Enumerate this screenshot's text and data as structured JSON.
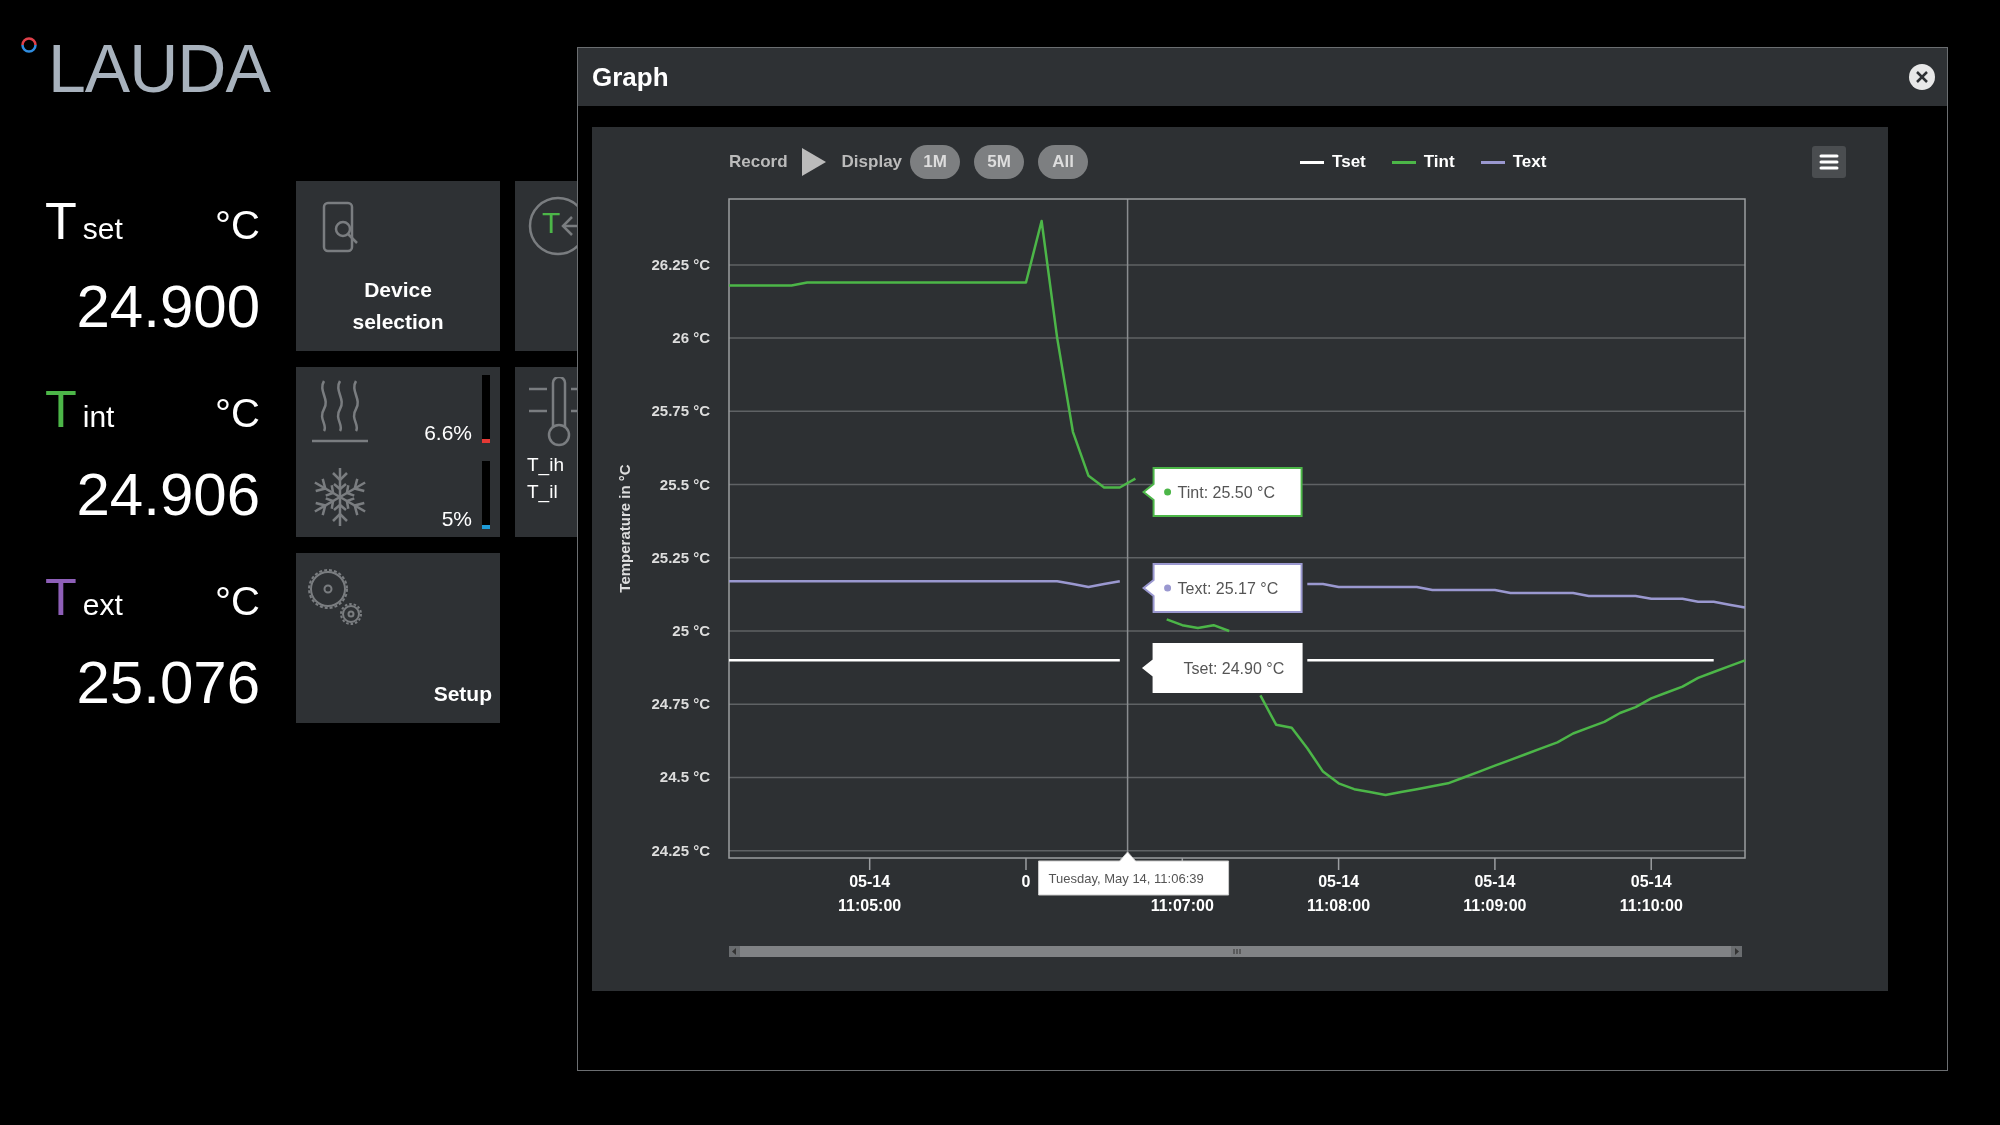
{
  "logo": {
    "text": "LAUDA"
  },
  "readouts": [
    {
      "symbol": "T",
      "sub": "set",
      "unit": "°C",
      "value": "24.900",
      "color": "#ffffff"
    },
    {
      "symbol": "T",
      "sub": "int",
      "unit": "°C",
      "value": "24.906",
      "color": "#4cb648"
    },
    {
      "symbol": "T",
      "sub": "ext",
      "unit": "°C",
      "value": "25.076",
      "color": "#8e5fb8"
    }
  ],
  "tiles": [
    {
      "kind": "device",
      "label": "Device selection"
    },
    {
      "kind": "mode",
      "symbol": "T"
    },
    {
      "kind": "power",
      "rows": [
        {
          "kind": "heat",
          "reading": "6.6%",
          "level": 0.066,
          "color": "#e53935"
        },
        {
          "kind": "cool",
          "reading": "5%",
          "level": 0.05,
          "color": "#1e9bd7"
        }
      ]
    },
    {
      "kind": "limits",
      "labels": [
        "T_ih",
        "T_il"
      ]
    },
    {
      "kind": "setup",
      "label": "Setup"
    }
  ],
  "graph_window": {
    "title": "Graph",
    "toolbar": {
      "record_label": "Record",
      "display_label": "Display",
      "ranges": [
        {
          "label": "1M"
        },
        {
          "label": "5M"
        },
        {
          "label": "All"
        }
      ]
    },
    "chart_data": {
      "type": "line",
      "ylabel": "Temperature in °C",
      "categories": [
        null,
        null,
        null,
        null,
        null,
        null,
        null,
        null,
        null,
        "05-14\n11:05:00",
        null,
        null,
        null,
        null,
        null,
        null,
        null,
        null,
        null,
        "0",
        null,
        null,
        null,
        null,
        null,
        null,
        null,
        null,
        null,
        "\n11:07:00",
        null,
        null,
        null,
        null,
        null,
        null,
        null,
        null,
        null,
        "05-14\n11:08:00",
        null,
        null,
        null,
        null,
        null,
        null,
        null,
        null,
        null,
        "05-14\n11:09:00",
        null,
        null,
        null,
        null,
        null,
        null,
        null,
        null,
        null,
        "05-14\n11:10:00",
        null,
        null,
        null,
        null,
        null,
        null
      ],
      "series": [
        {
          "name": "Tset",
          "color": "#ffffff",
          "values": [
            24.9,
            24.9,
            24.9,
            24.9,
            24.9,
            24.9,
            24.9,
            24.9,
            24.9,
            24.9,
            24.9,
            24.9,
            24.9,
            24.9,
            24.9,
            24.9,
            24.9,
            24.9,
            24.9,
            24.9,
            24.9,
            24.9,
            24.9,
            24.9,
            24.9,
            24.9,
            null,
            null,
            null,
            null,
            null,
            null,
            null,
            null,
            null,
            null,
            null,
            24.9,
            24.9,
            24.9,
            24.9,
            24.9,
            24.9,
            24.9,
            24.9,
            24.9,
            24.9,
            24.9,
            24.9,
            24.9,
            24.9,
            24.9,
            24.9,
            24.9,
            24.9,
            24.9,
            24.9,
            24.9,
            24.9,
            24.9,
            24.9,
            24.9,
            24.9,
            24.9,
            null,
            null
          ]
        },
        {
          "name": "Tint",
          "color": "#4cb648",
          "values": [
            26.18,
            26.18,
            26.18,
            26.18,
            26.18,
            26.19,
            26.19,
            26.19,
            26.19,
            26.19,
            26.19,
            26.19,
            26.19,
            26.19,
            26.19,
            26.19,
            26.19,
            26.19,
            26.19,
            26.19,
            26.4,
            26.0,
            25.68,
            25.53,
            25.49,
            25.49,
            25.52,
            null,
            25.04,
            25.02,
            25.01,
            25.02,
            25.0,
            null,
            24.78,
            24.68,
            24.67,
            24.6,
            24.52,
            24.48,
            24.46,
            24.45,
            24.44,
            24.45,
            24.46,
            24.47,
            24.48,
            24.5,
            24.52,
            24.54,
            24.56,
            24.58,
            24.6,
            24.62,
            24.65,
            24.67,
            24.69,
            24.72,
            24.74,
            24.77,
            24.79,
            24.81,
            24.84,
            24.86,
            24.88,
            24.9
          ]
        },
        {
          "name": "Text",
          "color": "#9a98d0",
          "values": [
            25.17,
            25.17,
            25.17,
            25.17,
            25.17,
            25.17,
            25.17,
            25.17,
            25.17,
            25.17,
            25.17,
            25.17,
            25.17,
            25.17,
            25.17,
            25.17,
            25.17,
            25.17,
            25.17,
            25.17,
            25.17,
            25.17,
            25.16,
            25.15,
            25.16,
            25.17,
            null,
            null,
            null,
            null,
            null,
            null,
            null,
            null,
            null,
            null,
            null,
            25.16,
            25.16,
            25.15,
            25.15,
            25.15,
            25.15,
            25.15,
            25.15,
            25.14,
            25.14,
            25.14,
            25.14,
            25.14,
            25.13,
            25.13,
            25.13,
            25.13,
            25.13,
            25.12,
            25.12,
            25.12,
            25.12,
            25.11,
            25.11,
            25.11,
            25.1,
            25.1,
            25.09,
            25.08
          ]
        }
      ],
      "grid": true,
      "ylim": [
        24.225,
        26.475
      ],
      "yticks": [
        {
          "value": 24.25,
          "label": "24.25 °C"
        },
        {
          "value": 24.5,
          "label": "24.5 °C"
        },
        {
          "value": 24.75,
          "label": "24.75 °C"
        },
        {
          "value": 25,
          "label": "25 °C"
        },
        {
          "value": 25.25,
          "label": "25.25 °C"
        },
        {
          "value": 25.5,
          "label": "25.5 °C"
        },
        {
          "value": 25.75,
          "label": "25.75 °C"
        },
        {
          "value": 26,
          "label": "26 °C"
        },
        {
          "value": 26.25,
          "label": "26.25 °C"
        }
      ]
    },
    "tooltips": [
      {
        "text": "Tint: 25.50 °C",
        "color": "#4cb648",
        "dot": true
      },
      {
        "text": "Text: 25.17 °C",
        "color": "#9a98d0",
        "dot": true
      },
      {
        "text": "Tset: 24.90 °C",
        "color": "#ffffff",
        "dot": false
      }
    ],
    "time_tooltip": "Tuesday, May 14, 11:06:39"
  }
}
